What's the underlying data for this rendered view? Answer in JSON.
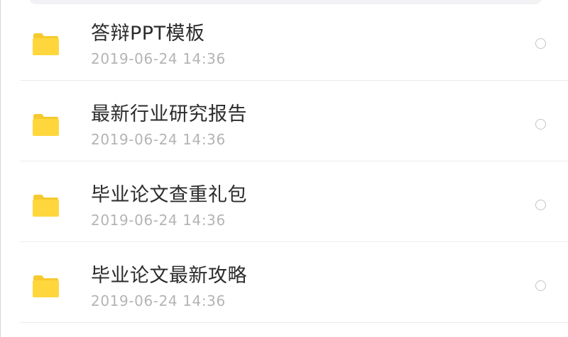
{
  "files": [
    {
      "name": "答辩PPT模板",
      "date": "2019-06-24  14:36",
      "icon": "folder-icon"
    },
    {
      "name": "最新行业研究报告",
      "date": "2019-06-24  14:36",
      "icon": "folder-icon"
    },
    {
      "name": "毕业论文查重礼包",
      "date": "2019-06-24  14:36",
      "icon": "folder-icon"
    },
    {
      "name": "毕业论文最新攻略",
      "date": "2019-06-24  14:36",
      "icon": "folder-icon"
    }
  ],
  "colors": {
    "folder": "#FFD73D",
    "folder_tab": "#F6C92E",
    "title_text": "#2B2B2B",
    "date_text": "#B4B4B4",
    "divider": "#ECECEC"
  }
}
